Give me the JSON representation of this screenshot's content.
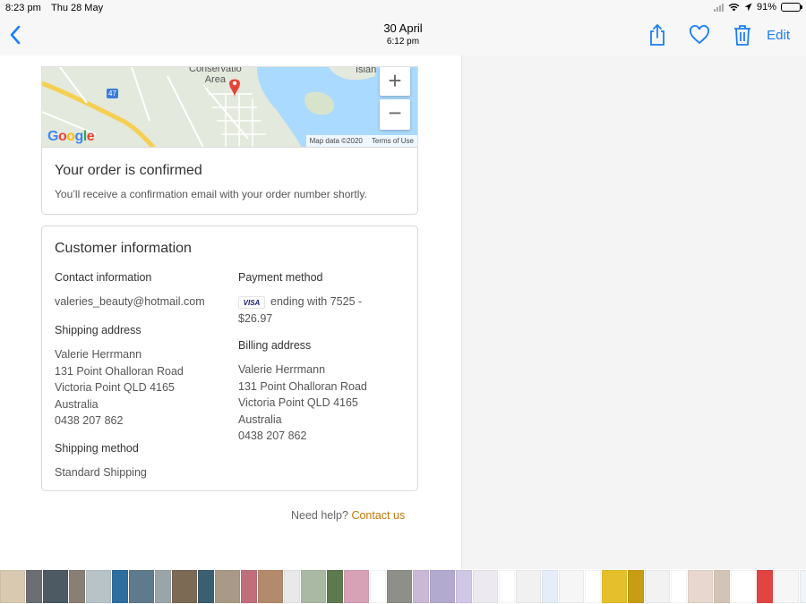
{
  "status_bar": {
    "time": "8:23 pm",
    "date": "Thu 28 May",
    "battery": "91%",
    "battery_level": 0.91
  },
  "nav": {
    "title": "30 April",
    "subtitle": "6:12 pm",
    "edit_label": "Edit",
    "icons": [
      "back-chevron-icon",
      "share-icon",
      "heart-icon",
      "trash-icon"
    ],
    "accent_color": "#1a7ef7"
  },
  "map": {
    "label_area": "Conservatio\nArea",
    "label_area_line1": "Conservatio",
    "label_area_line2": "Area",
    "label_island": "Islan",
    "road_number": "47",
    "google": "Google",
    "map_data": "Map data ©2020",
    "terms": "Terms of Use",
    "zoom_in": "+",
    "zoom_out": "−"
  },
  "confirmation": {
    "title": "Your order is confirmed",
    "message": "You’ll receive a confirmation email with your order number shortly."
  },
  "customer": {
    "title": "Customer information",
    "contact": {
      "heading": "Contact information",
      "email": "valeries_beauty@hotmail.com"
    },
    "payment": {
      "heading": "Payment method",
      "card_brand": "VISA",
      "detail": "ending with 7525 -",
      "amount": "$26.97"
    },
    "shipping_address": {
      "heading": "Shipping address",
      "name": "Valerie Herrmann",
      "street": "131 Point Ohalloran Road",
      "city": "Victoria Point QLD 4165",
      "country": "Australia",
      "phone": "0438 207 862"
    },
    "billing_address": {
      "heading": "Billing address",
      "name": "Valerie Herrmann",
      "street": "131 Point Ohalloran Road",
      "city": "Victoria Point QLD 4165",
      "country": "Australia",
      "phone": "0438 207 862"
    },
    "shipping_method": {
      "heading": "Shipping method",
      "value": "Standard Shipping"
    }
  },
  "help": {
    "text": "Need help?",
    "link": "Contact us",
    "link_color": "#c2780b"
  },
  "thumbnails": [
    "#d8c9b0",
    "#6b6f73",
    "#4d5a63",
    "#8a7f74",
    "#b7c3c7",
    "#2f6fa0",
    "#5f7a8c",
    "#9aa5a8",
    "#7c6a55",
    "#3c5e73",
    "#a89a86",
    "#c06f7a",
    "#b48a6c",
    "#e9e9e9",
    "#aab9a3",
    "#5d7a4e",
    "#d7a2b6",
    "#ffffff",
    "#8d8f88",
    "#c9b8d8",
    "#b3aad0",
    "#d0c6e6",
    "#ede9f1",
    "#ffffff",
    "#f1f1f1",
    "#e5eef8",
    "#f6f6f6",
    "#ffffff",
    "#e6c02a",
    "#c99c15",
    "#f2f2f2",
    "#ffffff",
    "#e8d7cf",
    "#d2c5b7",
    "#ffffff",
    "#e24343",
    "#f6f6f6",
    "#f1f5f9",
    "#d74a4a",
    "#ffffff",
    "#e9e4dc",
    "#f3f3f3",
    "#ffffff",
    "#4b4b56",
    "#d0d6df",
    "#f7f7f7",
    "#ffffff",
    "#7f8fb0",
    "#c8b8a8",
    "#888888"
  ]
}
